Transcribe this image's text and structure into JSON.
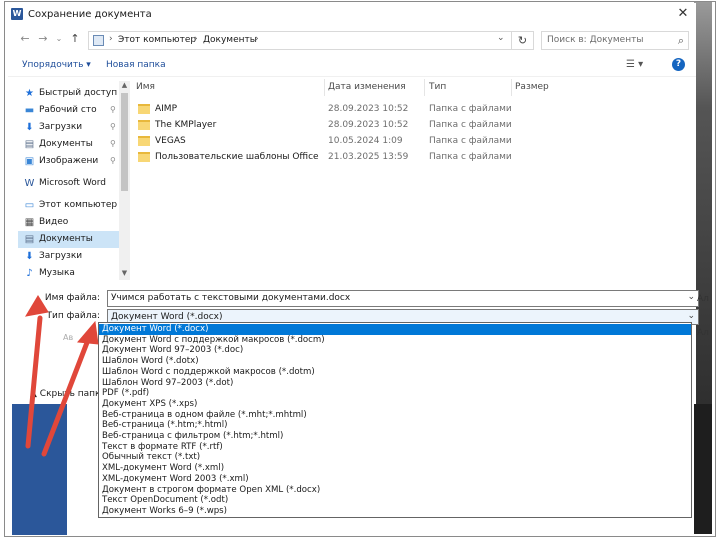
{
  "window": {
    "title": "Сохранение документа",
    "app_icon": "W",
    "close_glyph": "✕"
  },
  "navigation": {
    "path": [
      "Этот компьютер",
      "Документы"
    ],
    "search_placeholder": "Поиск в: Документы"
  },
  "toolbar": {
    "organize": "Упорядочить ▾",
    "new_folder": "Новая папка"
  },
  "sidebar": {
    "items": [
      {
        "label": "Быстрый доступ",
        "icon": "star-icon",
        "glyph": "★",
        "color": "#1e6fd9"
      },
      {
        "label": "Рабочий сто",
        "icon": "desktop-icon",
        "glyph": "▬",
        "color": "#3a86d6",
        "pinned": true
      },
      {
        "label": "Загрузки",
        "icon": "download-icon",
        "glyph": "⬇",
        "color": "#1e6fd9",
        "pinned": true
      },
      {
        "label": "Документы",
        "icon": "documents-icon",
        "glyph": "▤",
        "color": "#5a6e8a",
        "pinned": true
      },
      {
        "label": "Изображени",
        "icon": "pictures-icon",
        "glyph": "▣",
        "color": "#3a86d6",
        "pinned": true
      },
      {
        "label": "Microsoft Word",
        "icon": "word-icon",
        "glyph": "W",
        "color": "#2b579a"
      },
      {
        "label": "Этот компьютер",
        "icon": "computer-icon",
        "glyph": "▭",
        "color": "#3a86d6"
      },
      {
        "label": "Видео",
        "icon": "video-icon",
        "glyph": "▦",
        "color": "#4a4a4a"
      },
      {
        "label": "Документы",
        "icon": "documents-icon",
        "glyph": "▤",
        "color": "#5a6e8a",
        "selected": true
      },
      {
        "label": "Загрузки",
        "icon": "download-icon",
        "glyph": "⬇",
        "color": "#1e6fd9"
      },
      {
        "label": "Музыка",
        "icon": "music-icon",
        "glyph": "♪",
        "color": "#1e6fd9"
      }
    ]
  },
  "filelist": {
    "columns": [
      "Имя",
      "Дата изменения",
      "Тип",
      "Размер"
    ],
    "rows": [
      {
        "name": "AIMP",
        "date": "28.09.2023 10:52",
        "type": "Папка с файлами"
      },
      {
        "name": "The KMPlayer",
        "date": "28.09.2023 10:52",
        "type": "Папка с файлами"
      },
      {
        "name": "VEGAS",
        "date": "10.05.2024 1:09",
        "type": "Папка с файлами"
      },
      {
        "name": "Пользовательские шаблоны Office",
        "date": "21.03.2025 13:59",
        "type": "Папка с файлами"
      }
    ]
  },
  "form": {
    "filename_label": "Имя файла:",
    "filename_value": "Учимся работать с текстовыми документами.docx",
    "filetype_label": "Тип файла:",
    "filetype_value": "Документ Word (*.docx)",
    "authors_ghost": "Ав",
    "hide_folders": "Скрыть папки",
    "cutoff_text": "Ал"
  },
  "filetype_options": [
    "Документ Word (*.docx)",
    "Документ Word с поддержкой макросов (*.docm)",
    "Документ Word 97–2003 (*.doc)",
    "Шаблон Word (*.dotx)",
    "Шаблон Word с поддержкой макросов (*.dotm)",
    "Шаблон Word 97–2003 (*.dot)",
    "PDF (*.pdf)",
    "Документ XPS (*.xps)",
    "Веб-страница в одном файле (*.mht;*.mhtml)",
    "Веб-страница (*.htm;*.html)",
    "Веб-страница с фильтром (*.htm;*.html)",
    "Текст в формате RTF (*.rtf)",
    "Обычный текст (*.txt)",
    "XML-документ Word (*.xml)",
    "XML-документ Word 2003 (*.xml)",
    "Документ в строгом формате Open XML (*.docx)",
    "Текст OpenDocument (*.odt)",
    "Документ Works 6–9 (*.wps)"
  ],
  "colors": {
    "accent": "#0078d7",
    "word_blue": "#2b579a",
    "annotation_arrow": "#e0473a",
    "folder": "#f8d775"
  }
}
